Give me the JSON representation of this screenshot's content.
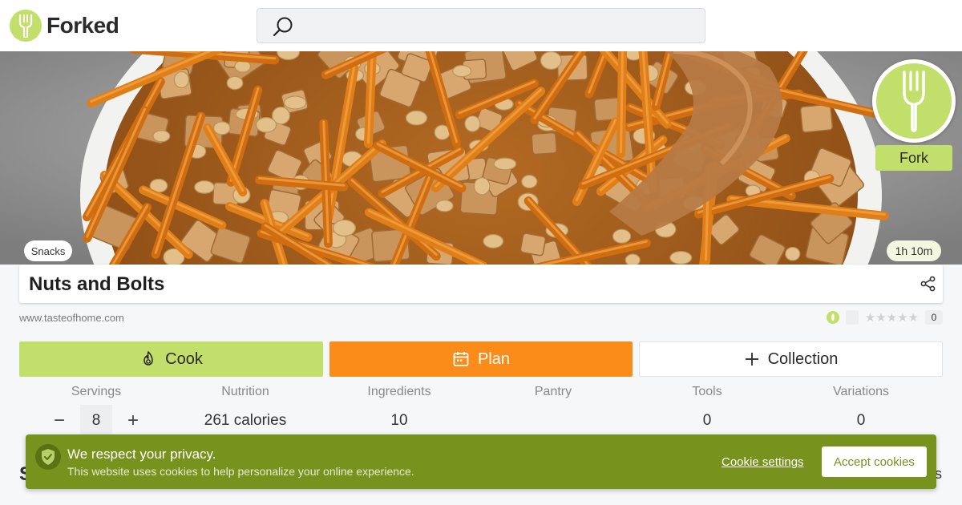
{
  "app": {
    "name": "Forked",
    "brand_color": "#c3df6b",
    "accent_color": "#fb8c1a"
  },
  "search": {
    "placeholder": "",
    "value": ""
  },
  "hero": {
    "image_subject": "snack-mix-bowl-photo",
    "fork_button_label": "Fork",
    "category_chip": "Snacks",
    "time_chip": "1h 10m"
  },
  "recipe": {
    "title": "Nuts and Bolts",
    "source": "www.tasteofhome.com",
    "rating_stars": 0,
    "rating_count": "0"
  },
  "actions": {
    "cook_label": "Cook",
    "plan_label": "Plan",
    "collection_label": "Collection"
  },
  "stats": {
    "servings_label": "Servings",
    "servings_value": "8",
    "decrement": "−",
    "increment": "+",
    "nutrition_label": "Nutrition",
    "nutrition_value": "261 calories",
    "ingredients_label": "Ingredients",
    "ingredients_value": "10",
    "pantry_label": "Pantry",
    "pantry_value": "",
    "tools_label": "Tools",
    "tools_value": "0",
    "variations_label": "Variations",
    "variations_value": "0"
  },
  "peek": {
    "left_text": "S",
    "right_text": "s"
  },
  "cookie_banner": {
    "title": "We respect your privacy.",
    "body": "This website uses cookies to help personalize your online experience.",
    "settings_label": "Cookie settings",
    "accept_label": "Accept cookies",
    "background_color": "#77921d"
  }
}
